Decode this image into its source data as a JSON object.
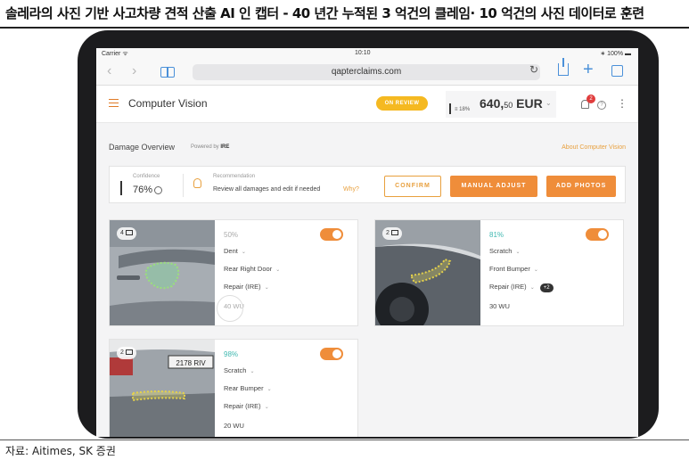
{
  "caption": {
    "title": "솔레라의 사진 기반 사고차량 견적 산출 AI 인 캡터 - 40 년간 누적된 3 억건의 클레임· 10 억건의 사진 데이터로 훈련",
    "source": "자료: Aitimes, SK 증권"
  },
  "statusbar": {
    "carrier": "Carrier ᯤ",
    "time": "10:10",
    "battery": "∗ 100% ▬"
  },
  "browser": {
    "url": "qapterclaims.com",
    "back": "‹",
    "forward": "›"
  },
  "app": {
    "title": "Computer Vision",
    "status_badge": "ON REVIEW",
    "pct": "≡ 18%",
    "price_main": "640,",
    "price_cents": "50",
    "price_currency": " EUR",
    "notifications": "2",
    "help": "?",
    "more": "⋮"
  },
  "overview": {
    "title": "Damage Overview",
    "powered_prefix": "Powered by",
    "powered_brand": "IRE",
    "about_link": "About Computer Vision"
  },
  "summary": {
    "confidence_label": "Confidence",
    "confidence_value": "76%",
    "recommendation_label": "Recommendation",
    "recommendation_text": "Review all damages and edit if needed",
    "why": "Why?",
    "confirm": "CONFIRM",
    "manual_adjust": "MANUAL ADJUST",
    "add_photos": "ADD PHOTOS"
  },
  "cards": [
    {
      "photos": "4",
      "confidence": "50%",
      "type": "Dent",
      "part": "Rear Right Door",
      "repair": "Repair (IRE)",
      "extra": "",
      "wu": "40 WU"
    },
    {
      "photos": "2",
      "confidence": "81%",
      "type": "Scratch",
      "part": "Front Bumper",
      "repair": "Repair (IRE)",
      "extra": "+2",
      "wu": "30 WU"
    },
    {
      "photos": "2",
      "confidence": "98%",
      "type": "Scratch",
      "part": "Rear Bumper",
      "repair": "Repair (IRE)",
      "extra": "",
      "wu": "20 WU",
      "plate": "2178 RIV"
    }
  ],
  "colors": {
    "accent": "#ef8d3a",
    "badge": "#f5b921",
    "teal": "#3fb8b0",
    "frame": "#1c1c1e"
  }
}
